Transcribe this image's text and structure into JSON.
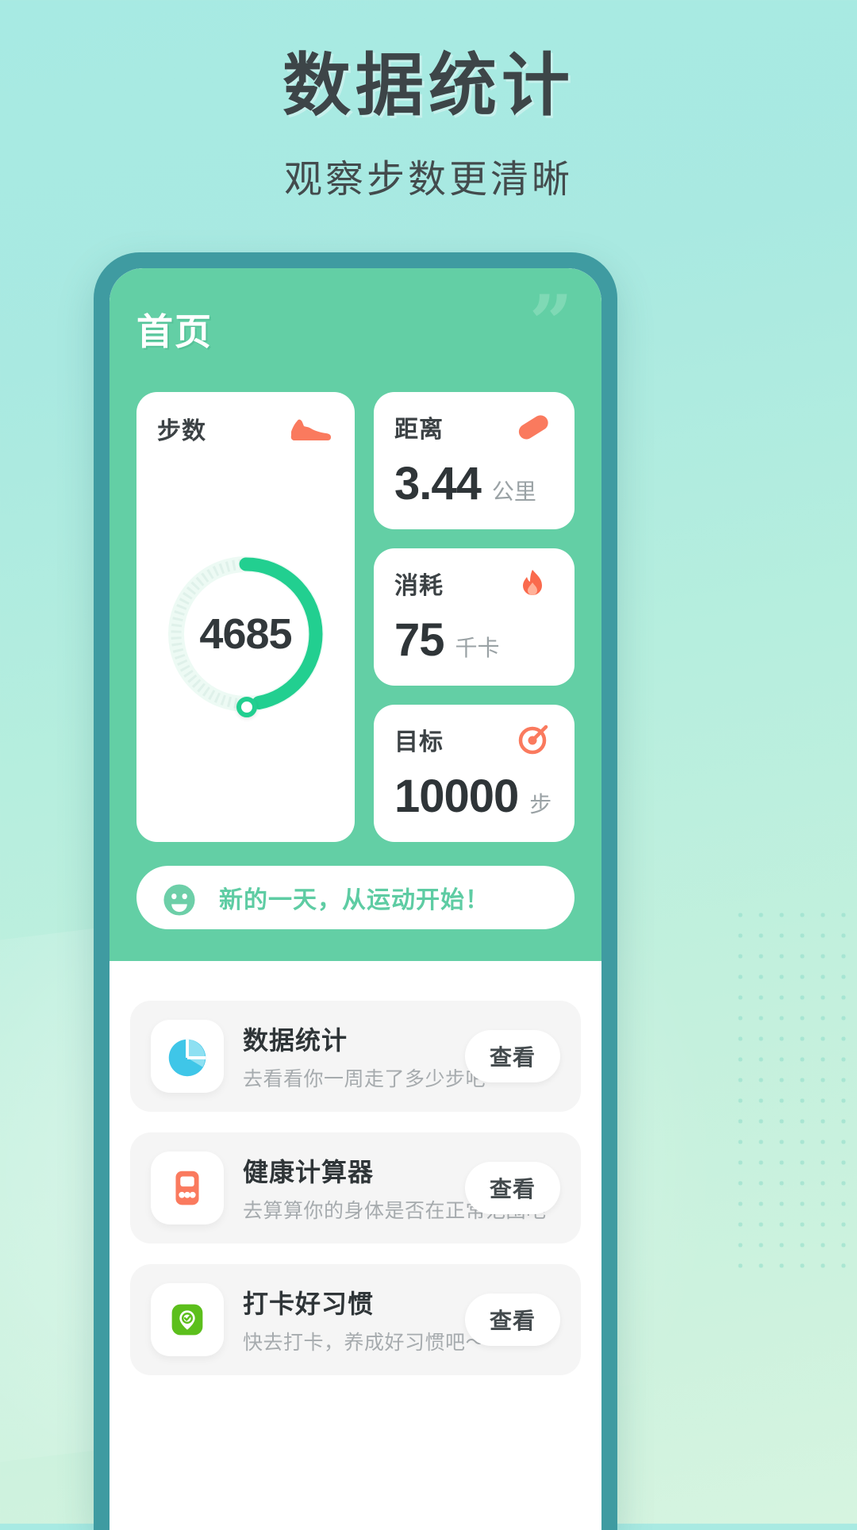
{
  "headline": {
    "title": "数据统计",
    "subtitle": "观察步数更清晰"
  },
  "colors": {
    "background_top": "#a7eae3",
    "background_bottom": "#d6f4e0",
    "phone_frame": "#3f9ba1",
    "screen_green": "#63cfa5",
    "ring_progress": "#22cf90",
    "ring_track": "#e6f7f0",
    "accent_coral": "#fa7a5e",
    "banner_text": "#5ecca3"
  },
  "phone": {
    "page_title": "首页",
    "quote_icon": "quote-mark-icon",
    "steps_card": {
      "label": "步数",
      "icon": "running-shoe-icon",
      "value": "4685",
      "goal": 10000,
      "progress_percent": 47
    },
    "mini_cards": [
      {
        "label": "距离",
        "icon": "pill-capsule-icon",
        "value": "3.44",
        "unit": "公里"
      },
      {
        "label": "消耗",
        "icon": "flame-icon",
        "value": "75",
        "unit": "千卡"
      },
      {
        "label": "目标",
        "icon": "target-icon",
        "value": "10000",
        "unit": "步"
      }
    ],
    "banner": {
      "icon": "smiley-face-icon",
      "text": "新的一天，从运动开始！"
    },
    "list": {
      "action_label": "查看",
      "items": [
        {
          "icon": "pie-chart-icon",
          "title": "数据统计",
          "subtitle": "去看看你一周走了多少步吧～",
          "action": "查看"
        },
        {
          "icon": "calculator-icon",
          "title": "健康计算器",
          "subtitle": "去算算你的身体是否在正常范围吧",
          "action": "查看"
        },
        {
          "icon": "location-check-icon",
          "title": "打卡好习惯",
          "subtitle": "快去打卡，养成好习惯吧～",
          "action": "查看"
        }
      ]
    }
  }
}
